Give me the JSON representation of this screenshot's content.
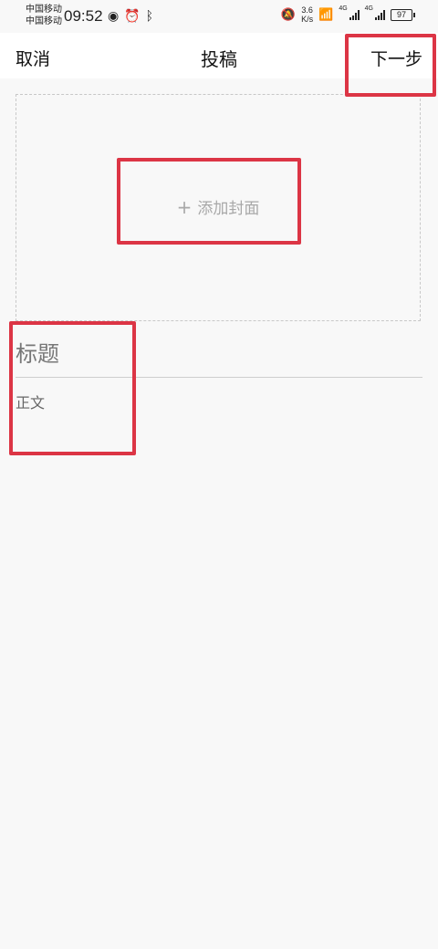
{
  "status_bar": {
    "carrier1": "中国移动",
    "carrier2": "中国移动",
    "time": "09:52",
    "speed_value": "3.6",
    "speed_unit": "K/s",
    "network1": "4G",
    "network2": "4G",
    "battery": "97"
  },
  "header": {
    "cancel_label": "取消",
    "title": "投稿",
    "next_label": "下一步"
  },
  "cover": {
    "add_label": "添加封面"
  },
  "editor": {
    "title_placeholder": "标题",
    "body_placeholder": "正文"
  },
  "colors": {
    "highlight": "#dc3545",
    "background": "#f8f8f8",
    "header_bg": "#ffffff",
    "placeholder": "#a8a8a8"
  }
}
